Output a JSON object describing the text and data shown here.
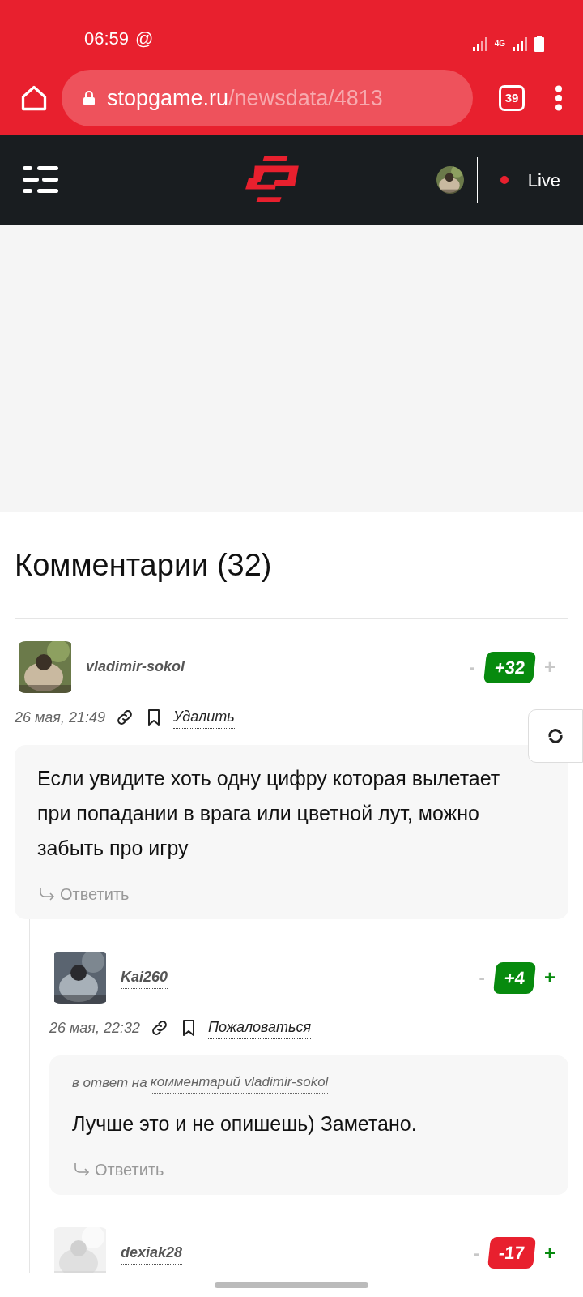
{
  "status_bar": {
    "time": "06:59",
    "at_sign": "@",
    "network": "4G"
  },
  "browser": {
    "url_host": "stopgame.ru",
    "url_path": "/newsdata/4813",
    "tab_count": "39"
  },
  "site_nav": {
    "live_label": "Live"
  },
  "comments_heading": "Комментарии (32)",
  "comments": [
    {
      "author": "vladimir-sokol",
      "date": "26 мая, 21:49",
      "action": "Удалить",
      "minus": "-",
      "plus": "+",
      "rating": "+32",
      "color": "#078a0e",
      "plus_active": false,
      "text": "Если увидите хоть одну цифру которая вылетает при попадании в врага или цветной лут, можно забыть про игру",
      "reply": "Ответить",
      "children": [
        {
          "author": "Kai260",
          "date": "26 мая, 22:32",
          "action": "Пожаловаться",
          "minus": "-",
          "plus": "+",
          "rating": "+4",
          "color": "#078a0e",
          "plus_active": true,
          "reply_to_prefix": "в ответ на",
          "reply_to_link": "комментарий vladimir-sokol",
          "text": "Лучше это и не опишешь) Заметано.",
          "reply": "Ответить"
        },
        {
          "author": "dexiak28",
          "minus": "-",
          "plus": "+",
          "rating": "-17",
          "color": "#e8202e",
          "plus_active": true
        }
      ]
    }
  ]
}
